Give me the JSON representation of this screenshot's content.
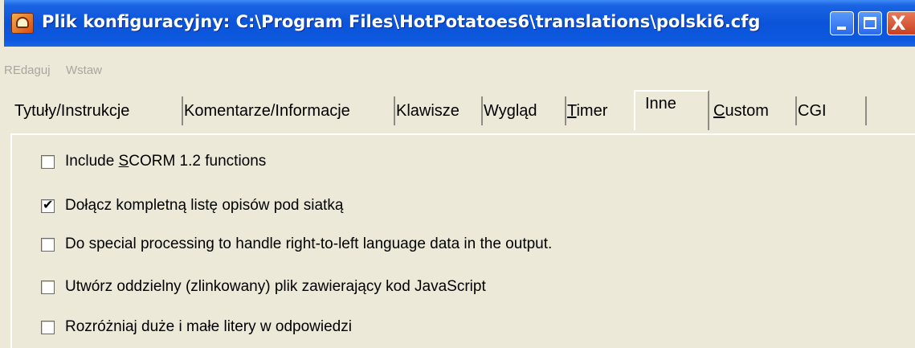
{
  "window": {
    "title": "Plik konfiguracyjny: C:\\Program Files\\HotPotatoes6\\translations\\polski6.cfg",
    "close_glyph": "X"
  },
  "menu": [
    "REdaguj",
    "Wstaw"
  ],
  "tabs": [
    {
      "label": "Tytuły/Instrukcje",
      "active": false
    },
    {
      "label": "Komentarze/Informacje",
      "active": false
    },
    {
      "label": "Klawisze",
      "active": false
    },
    {
      "label": "Wygląd",
      "active": false
    },
    {
      "label_underlined": "T",
      "label_rest": "imer",
      "active": false
    },
    {
      "label": "Inne",
      "active": true
    },
    {
      "label_underlined": "C",
      "label_rest": "ustom",
      "active": false
    },
    {
      "label": "CGI",
      "active": false
    }
  ],
  "options": [
    {
      "label_pre": "Include ",
      "label_underlined": "S",
      "label_post": "CORM 1.2 functions",
      "checked": false
    },
    {
      "label": "Dołącz kompletną listę opisów pod siatką",
      "checked": true
    },
    {
      "label": "Do special processing to handle right-to-left language data in the output.",
      "checked": false
    },
    {
      "label": "Utwórz oddzielny (zlinkowany) plik zawierający kod JavaScript",
      "checked": false
    },
    {
      "label": "Rozróżniaj duże i małe litery w odpowiedzi",
      "checked": false
    }
  ],
  "check_glyph": "✔",
  "icons": [
    "app-icon",
    "minimize-icon",
    "maximize-icon",
    "close-icon"
  ],
  "colors": {
    "titlebar": "#0b54d9",
    "face": "#ece9d8",
    "menu_disabled": "#a9a6a0"
  }
}
